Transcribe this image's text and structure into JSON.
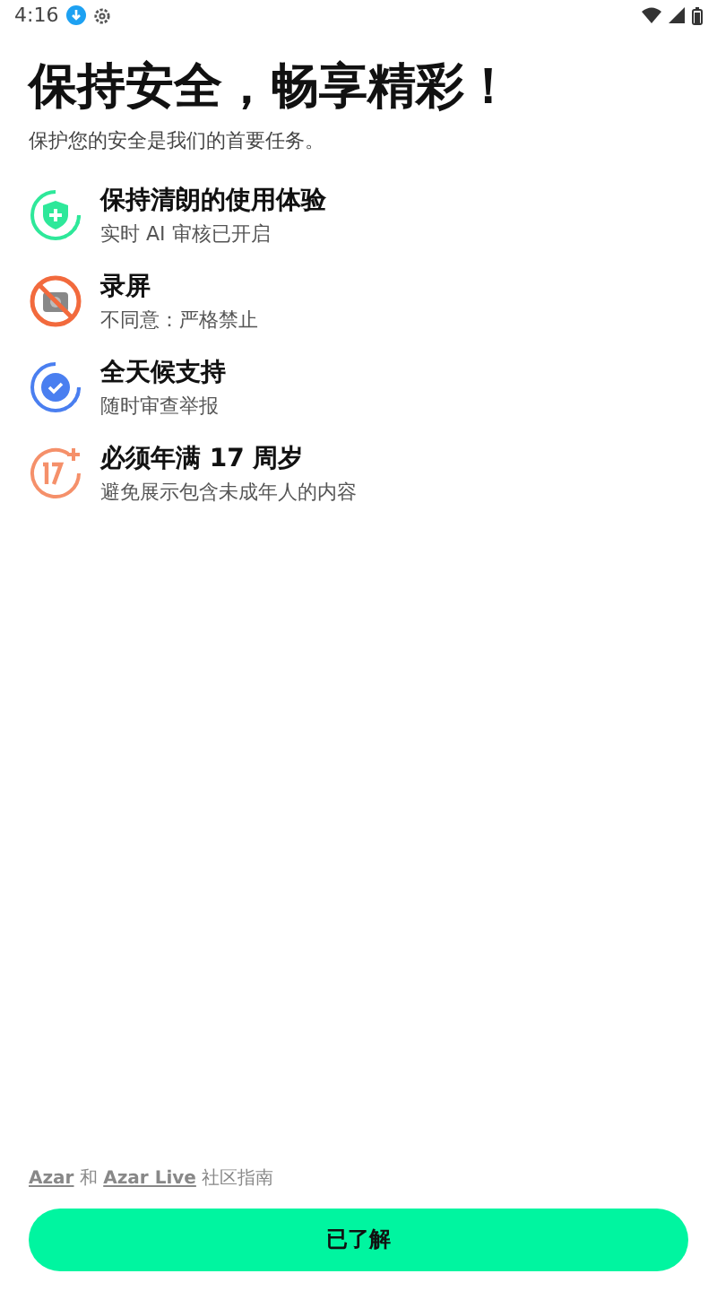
{
  "status_bar": {
    "time": "4:16"
  },
  "title": "保持安全，畅享精彩！",
  "subtitle": "保护您的安全是我们的首要任务。",
  "features": [
    {
      "kind": "shield",
      "color": "#2ee89a",
      "title": "保持清朗的使用体验",
      "description": "实时 AI 审核已开启"
    },
    {
      "kind": "no-camera",
      "color": "#f26a3d",
      "title": "录屏",
      "description": "不同意：严格禁止"
    },
    {
      "kind": "check",
      "color": "#4a7ff0",
      "title": "全天候支持",
      "description": "随时审查举报"
    },
    {
      "kind": "age",
      "color": "#f5906a",
      "title": "必须年满 17 周岁",
      "description": "避免展示包含未成年人的内容"
    }
  ],
  "footer": {
    "parts": [
      {
        "kind": "link",
        "text": "Azar"
      },
      {
        "kind": "text",
        "text": " 和 "
      },
      {
        "kind": "link",
        "text": "Azar Live"
      },
      {
        "kind": "text",
        "text": " 社区指南"
      }
    ]
  },
  "button": "已了解"
}
